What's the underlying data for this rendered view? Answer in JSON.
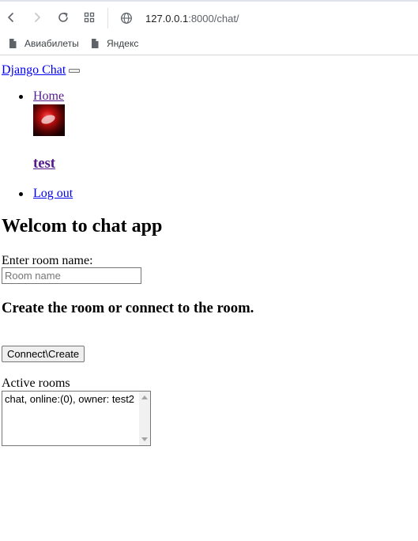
{
  "browser": {
    "url_host": "127.0.0.1",
    "url_rest": ":8000/chat/",
    "bookmarks": [
      {
        "label": "Авиабилеты"
      },
      {
        "label": "Яндекс"
      }
    ]
  },
  "navbar": {
    "brand": "Django Chat",
    "home": "Home",
    "username": "test",
    "logout": "Log out"
  },
  "main": {
    "heading": "Welcom to chat app",
    "room_label": "Enter room name:",
    "room_placeholder": "Room name",
    "subheading": "Create the room or connect to the room.",
    "connect_button": "Connect\\Create",
    "rooms_label": "Active rooms",
    "rooms_text": "chat, online:(0), owner: test2"
  }
}
